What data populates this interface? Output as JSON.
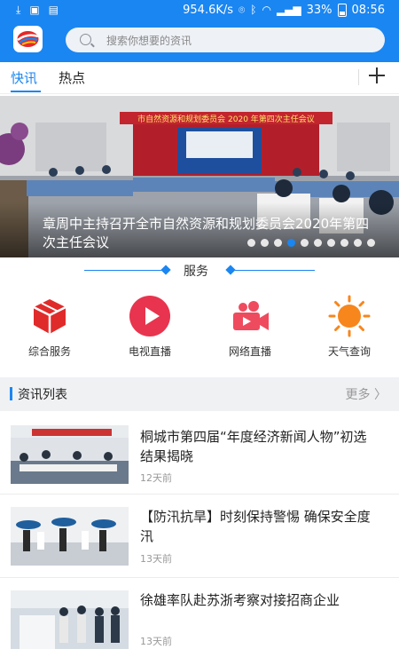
{
  "status_bar": {
    "speed": "954.6K/s",
    "battery": "33%",
    "time": "08:56"
  },
  "search": {
    "placeholder": "搜索你想要的资讯"
  },
  "tabs": [
    {
      "label": "快讯",
      "active": true
    },
    {
      "label": "热点",
      "active": false
    }
  ],
  "banner": {
    "caption": "章周中主持召开全市自然资源和规划委员会2020年第四次主任会议",
    "room_banner_text": "市自然资源和规划委员会 2020 年第四次主任会议",
    "slide_count": 10,
    "active_slide": 4
  },
  "services": {
    "title": "服务",
    "items": [
      {
        "label": "综合服务",
        "icon": "cube-icon",
        "color": "#e02b2b"
      },
      {
        "label": "电视直播",
        "icon": "play-icon",
        "color": "#e8344e"
      },
      {
        "label": "网络直播",
        "icon": "video-camera-icon",
        "color": "#ef4b5e"
      },
      {
        "label": "天气查询",
        "icon": "sun-icon",
        "color": "#f7861d"
      }
    ]
  },
  "news_list": {
    "title": "资讯列表",
    "more_label": "更多",
    "items": [
      {
        "title": "桐城市第四届“年度经济新闻人物”初选结果揭晓",
        "time": "12天前"
      },
      {
        "title": "【防汛抗旱】时刻保持警惕 确保安全度汛",
        "time": "13天前"
      },
      {
        "title": "徐雄率队赴苏浙考察对接招商企业",
        "time": "13天前"
      }
    ]
  },
  "colors": {
    "accent": "#1a86f2",
    "separator": "#f0f1f3"
  }
}
